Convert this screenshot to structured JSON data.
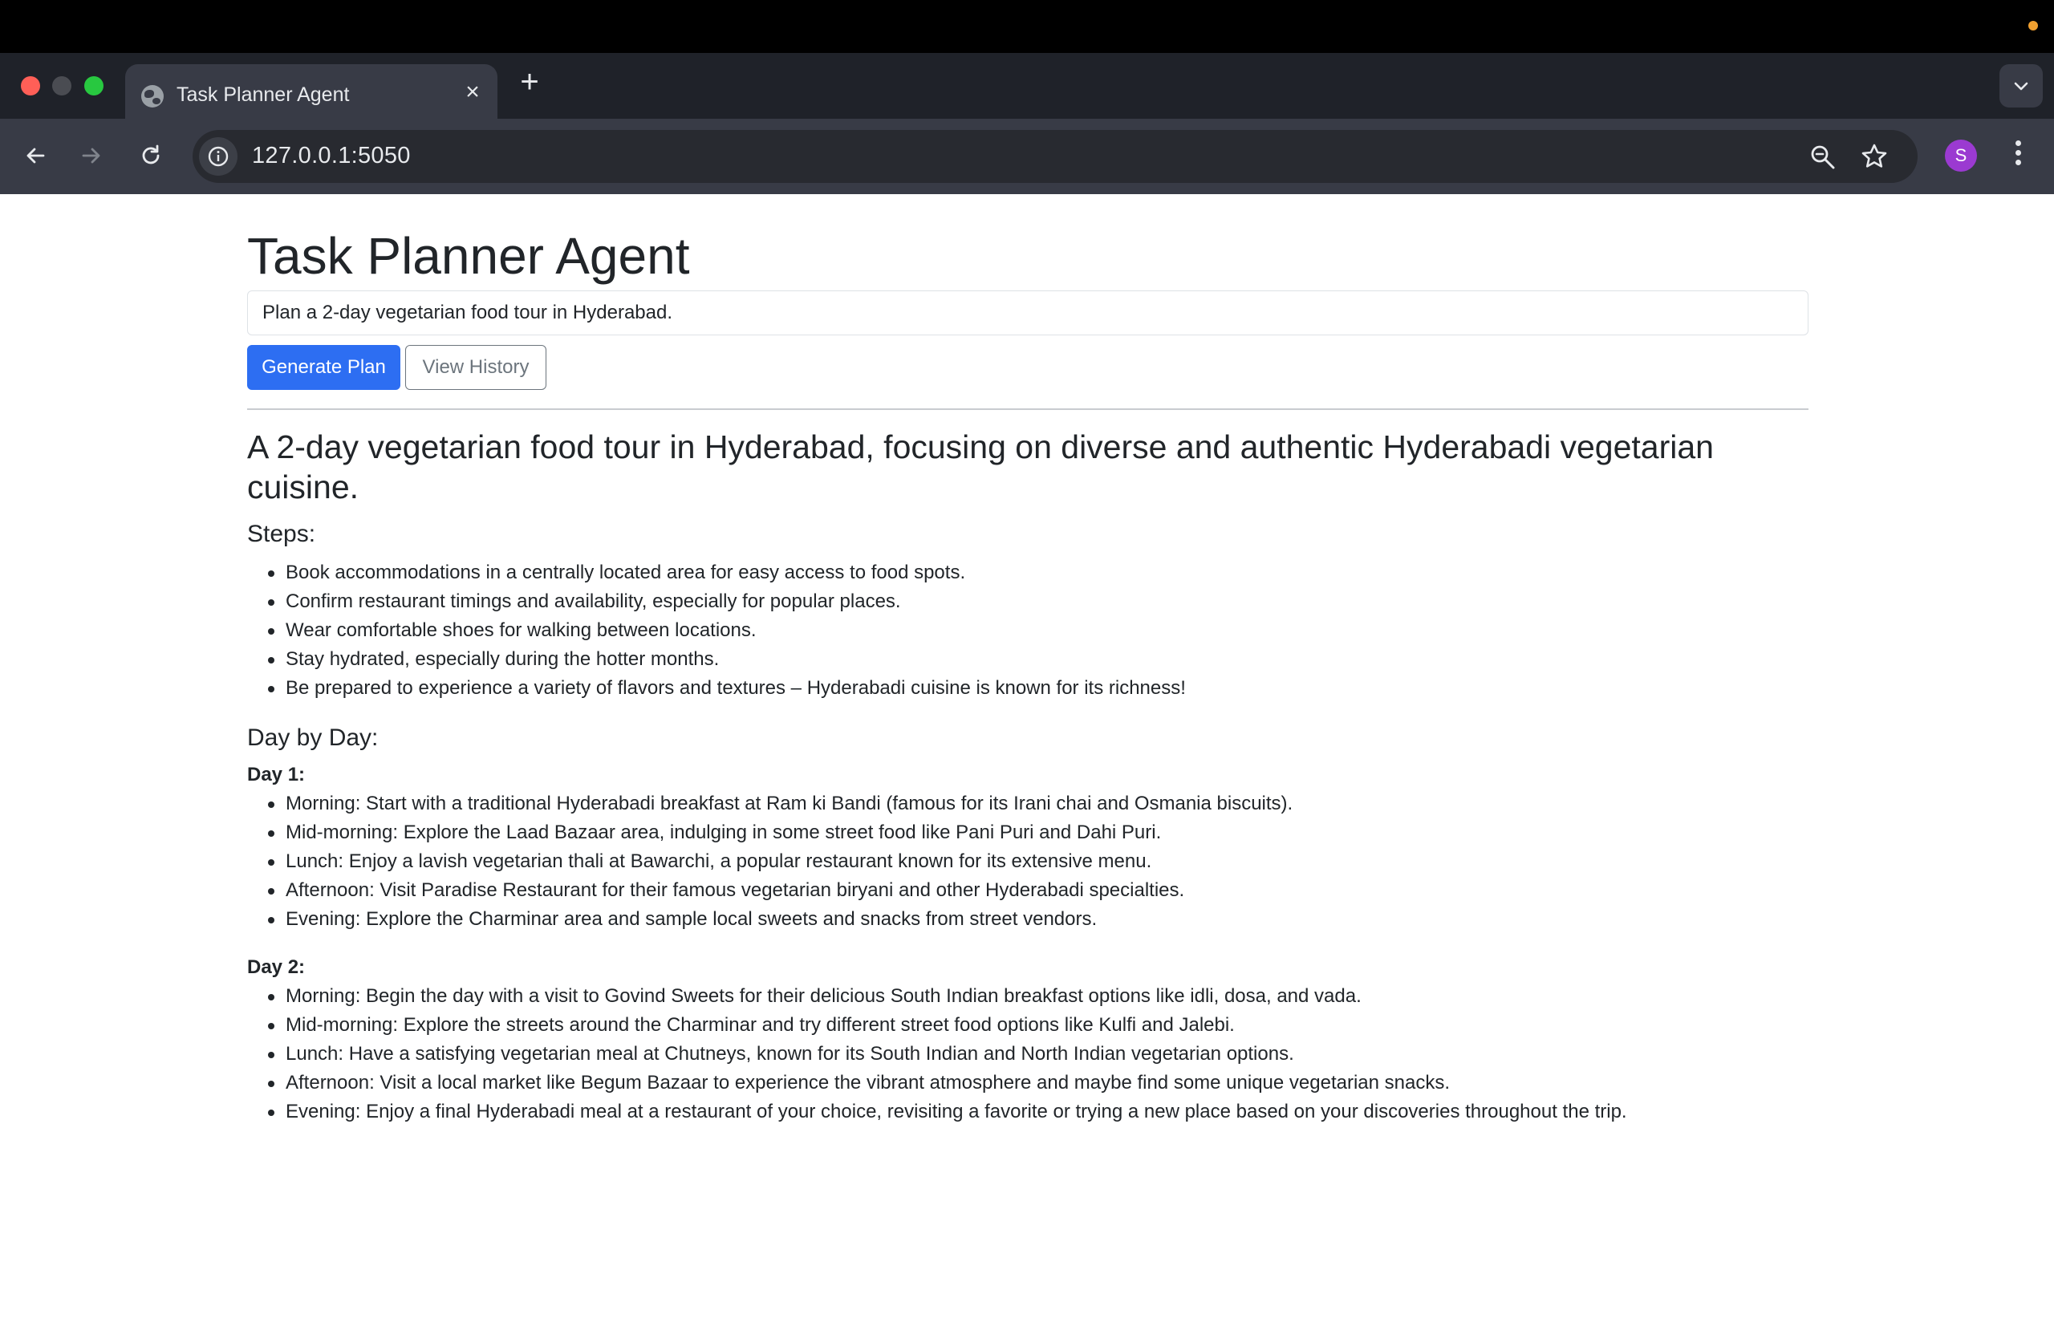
{
  "browser": {
    "tab_title": "Task Planner Agent",
    "url": "127.0.0.1:5050",
    "profile_initial": "S"
  },
  "app": {
    "title": "Task Planner Agent",
    "task_input_value": "Plan a 2-day vegetarian food tour in Hyderabad.",
    "generate_button": "Generate Plan",
    "history_button": "View History"
  },
  "plan": {
    "summary": "A 2-day vegetarian food tour in Hyderabad, focusing on diverse and authentic Hyderabadi vegetarian cuisine.",
    "steps_heading": "Steps:",
    "steps": [
      "Book accommodations in a centrally located area for easy access to food spots.",
      "Confirm restaurant timings and availability, especially for popular places.",
      "Wear comfortable shoes for walking between locations.",
      "Stay hydrated, especially during the hotter months.",
      "Be prepared to experience a variety of flavors and textures – Hyderabadi cuisine is known for its richness!"
    ],
    "day_by_day_heading": "Day by Day:",
    "days": [
      {
        "label": "Day 1:",
        "items": [
          "Morning: Start with a traditional Hyderabadi breakfast at Ram ki Bandi (famous for its Irani chai and Osmania biscuits).",
          "Mid-morning: Explore the Laad Bazaar area, indulging in some street food like Pani Puri and Dahi Puri.",
          "Lunch: Enjoy a lavish vegetarian thali at Bawarchi, a popular restaurant known for its extensive menu.",
          "Afternoon: Visit Paradise Restaurant for their famous vegetarian biryani and other Hyderabadi specialties.",
          "Evening: Explore the Charminar area and sample local sweets and snacks from street vendors."
        ]
      },
      {
        "label": "Day 2:",
        "items": [
          "Morning: Begin the day with a visit to Govind Sweets for their delicious South Indian breakfast options like idli, dosa, and vada.",
          "Mid-morning: Explore the streets around the Charminar and try different street food options like Kulfi and Jalebi.",
          "Lunch: Have a satisfying vegetarian meal at Chutneys, known for its South Indian and North Indian vegetarian options.",
          "Afternoon: Visit a local market like Begum Bazaar to experience the vibrant atmosphere and maybe find some unique vegetarian snacks.",
          "Evening: Enjoy a final Hyderabadi meal at a restaurant of your choice, revisiting a favorite or trying a new place based on your discoveries throughout the trip."
        ]
      }
    ]
  },
  "colors": {
    "primary": "#2d6ef2",
    "secondary": "#6c757d",
    "text": "#212529",
    "chrome_dark": "#1f2229",
    "chrome_toolbar": "#383b46",
    "profile": "#9b3ad1"
  }
}
